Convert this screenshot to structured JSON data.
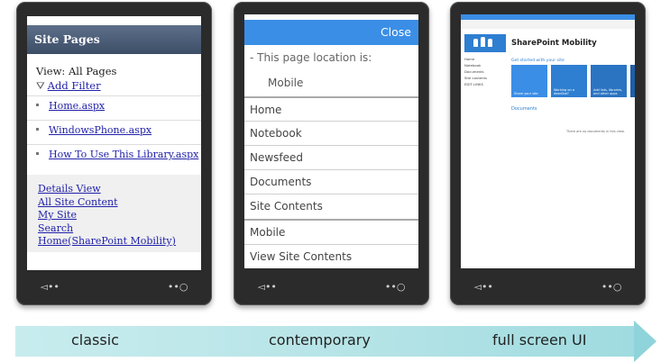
{
  "labels": {
    "classic": "classic",
    "contemporary": "contemporary",
    "fullscreen": "full screen UI"
  },
  "classic": {
    "title": "Site Pages",
    "view": "View: All Pages",
    "add_filter": "Add Filter",
    "pages": [
      "Home.aspx",
      "WindowsPhone.aspx",
      "How To Use This Library.aspx"
    ],
    "links": [
      "Details View",
      "All Site Content",
      "My Site",
      "Search",
      "Home(SharePoint Mobility)"
    ]
  },
  "contemporary": {
    "close": "Close",
    "location_label": "- This page location is:",
    "location_value": "Mobile",
    "menu": [
      "Home",
      "Notebook",
      "Newsfeed",
      "Documents",
      "Site Contents",
      "Mobile",
      "View Site Contents"
    ]
  },
  "fullscreen": {
    "site_title": "SharePoint Mobility",
    "get_started": "Get started with your site",
    "left_nav": [
      "Home",
      "Notebook",
      "Documents",
      "",
      "Site contents",
      "EDIT LINKS"
    ],
    "tiles": [
      {
        "label": "Share your site",
        "color": "#3a8ee6"
      },
      {
        "label": "Working on a deadline?",
        "color": "#2e7fd1"
      },
      {
        "label": "Add lists, libraries, and other apps",
        "color": "#2a74c2"
      },
      {
        "label": "",
        "color": "#1f5ea8"
      }
    ],
    "documents": "Documents",
    "empty_msg": "There are no documents in this view."
  },
  "nav": {
    "back": "◅••",
    "search": "••○"
  }
}
